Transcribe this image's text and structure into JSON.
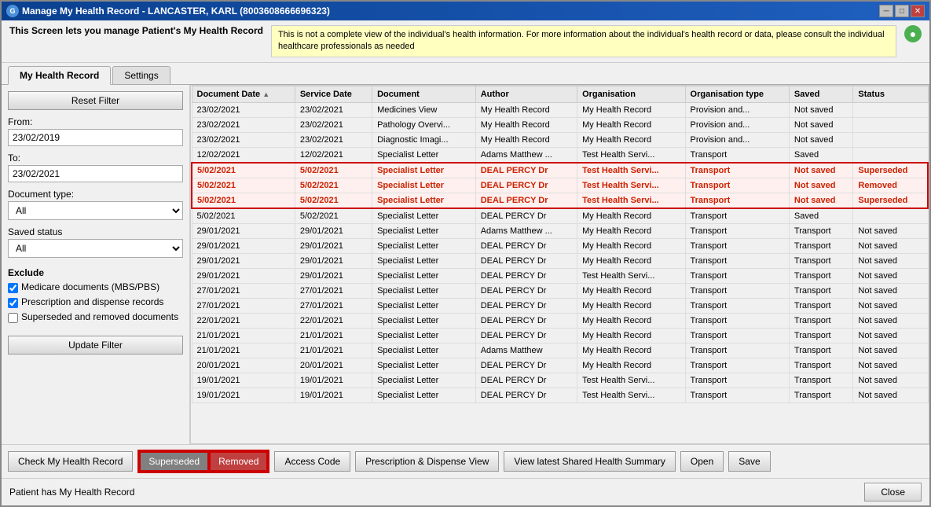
{
  "window": {
    "title": "Manage My Health Record - LANCASTER, KARL (8003608666696323)",
    "icon_label": "G"
  },
  "info_bar": {
    "left_text": "This Screen lets you manage Patient's My Health Record",
    "right_text": "This is not a complete view of the individual's health information. For more information about the individual's health record or data, please consult the individual healthcare professionals as needed"
  },
  "tabs": [
    {
      "label": "My Health Record",
      "active": true
    },
    {
      "label": "Settings",
      "active": false
    }
  ],
  "filter": {
    "reset_label": "Reset Filter",
    "from_label": "From:",
    "from_value": "23/02/2019",
    "to_label": "To:",
    "to_value": "23/02/2021",
    "doc_type_label": "Document type:",
    "doc_type_value": "All",
    "saved_status_label": "Saved status",
    "saved_status_value": "All",
    "exclude_title": "Exclude",
    "checkboxes": [
      {
        "label": "Medicare documents (MBS/PBS)",
        "checked": true
      },
      {
        "label": "Prescription and dispense records",
        "checked": true
      },
      {
        "label": "Superseded and removed documents",
        "checked": false
      }
    ],
    "update_label": "Update Filter"
  },
  "table": {
    "columns": [
      "Document Date",
      "Service Date",
      "Document",
      "Author",
      "Organisation",
      "Organisation type",
      "Saved",
      "Status"
    ],
    "rows": [
      {
        "doc_date": "23/02/2021",
        "svc_date": "23/02/2021",
        "document": "Medicines View",
        "author": "My Health Record",
        "org": "My Health Record",
        "org_type": "Provision and...",
        "saved": "Not saved",
        "status": "",
        "highlighted": false
      },
      {
        "doc_date": "23/02/2021",
        "svc_date": "23/02/2021",
        "document": "Pathology Overvi...",
        "author": "My Health Record",
        "org": "My Health Record",
        "org_type": "Provision and...",
        "saved": "Not saved",
        "status": "",
        "highlighted": false
      },
      {
        "doc_date": "23/02/2021",
        "svc_date": "23/02/2021",
        "document": "Diagnostic Imagi...",
        "author": "My Health Record",
        "org": "My Health Record",
        "org_type": "Provision and...",
        "saved": "Not saved",
        "status": "",
        "highlighted": false
      },
      {
        "doc_date": "12/02/2021",
        "svc_date": "12/02/2021",
        "document": "Specialist Letter",
        "author": "Adams Matthew ...",
        "org": "Test Health Servi...",
        "org_type": "Transport",
        "saved": "Saved",
        "status": "",
        "highlighted": false
      },
      {
        "doc_date": "5/02/2021",
        "svc_date": "5/02/2021",
        "document": "Specialist Letter",
        "author": "DEAL PERCY  Dr",
        "org": "Test Health Servi...",
        "org_type": "Transport",
        "saved": "Not saved",
        "status": "Superseded",
        "highlighted": true
      },
      {
        "doc_date": "5/02/2021",
        "svc_date": "5/02/2021",
        "document": "Specialist Letter",
        "author": "DEAL PERCY  Dr",
        "org": "Test Health Servi...",
        "org_type": "Transport",
        "saved": "Not saved",
        "status": "Removed",
        "highlighted": true
      },
      {
        "doc_date": "5/02/2021",
        "svc_date": "5/02/2021",
        "document": "Specialist Letter",
        "author": "DEAL PERCY  Dr",
        "org": "Test Health Servi...",
        "org_type": "Transport",
        "saved": "Not saved",
        "status": "Superseded",
        "highlighted": true
      },
      {
        "doc_date": "5/02/2021",
        "svc_date": "5/02/2021",
        "document": "Specialist Letter",
        "author": "DEAL PERCY  Dr",
        "org": "My Health Record",
        "org_type": "Transport",
        "saved": "Saved",
        "status": "",
        "highlighted": false
      },
      {
        "doc_date": "29/01/2021",
        "svc_date": "29/01/2021",
        "document": "Specialist Letter",
        "author": "Adams Matthew ...",
        "org": "My Health Record",
        "org_type": "Transport",
        "saved": "Transport",
        "status": "Not saved",
        "highlighted": false
      },
      {
        "doc_date": "29/01/2021",
        "svc_date": "29/01/2021",
        "document": "Specialist Letter",
        "author": "DEAL PERCY  Dr",
        "org": "My Health Record",
        "org_type": "Transport",
        "saved": "Transport",
        "status": "Not saved",
        "highlighted": false
      },
      {
        "doc_date": "29/01/2021",
        "svc_date": "29/01/2021",
        "document": "Specialist Letter",
        "author": "DEAL PERCY  Dr",
        "org": "My Health Record",
        "org_type": "Transport",
        "saved": "Transport",
        "status": "Not saved",
        "highlighted": false
      },
      {
        "doc_date": "29/01/2021",
        "svc_date": "29/01/2021",
        "document": "Specialist Letter",
        "author": "DEAL PERCY  Dr",
        "org": "Test Health Servi...",
        "org_type": "Transport",
        "saved": "Transport",
        "status": "Not saved",
        "highlighted": false
      },
      {
        "doc_date": "27/01/2021",
        "svc_date": "27/01/2021",
        "document": "Specialist Letter",
        "author": "DEAL PERCY  Dr",
        "org": "My Health Record",
        "org_type": "Transport",
        "saved": "Transport",
        "status": "Not saved",
        "highlighted": false
      },
      {
        "doc_date": "27/01/2021",
        "svc_date": "27/01/2021",
        "document": "Specialist Letter",
        "author": "DEAL PERCY  Dr",
        "org": "My Health Record",
        "org_type": "Transport",
        "saved": "Transport",
        "status": "Not saved",
        "highlighted": false
      },
      {
        "doc_date": "22/01/2021",
        "svc_date": "22/01/2021",
        "document": "Specialist Letter",
        "author": "DEAL PERCY  Dr",
        "org": "My Health Record",
        "org_type": "Transport",
        "saved": "Transport",
        "status": "Not saved",
        "highlighted": false
      },
      {
        "doc_date": "21/01/2021",
        "svc_date": "21/01/2021",
        "document": "Specialist Letter",
        "author": "DEAL PERCY  Dr",
        "org": "My Health Record",
        "org_type": "Transport",
        "saved": "Transport",
        "status": "Not saved",
        "highlighted": false
      },
      {
        "doc_date": "21/01/2021",
        "svc_date": "21/01/2021",
        "document": "Specialist Letter",
        "author": "Adams Matthew",
        "org": "My Health Record",
        "org_type": "Transport",
        "saved": "Transport",
        "status": "Not saved",
        "highlighted": false
      },
      {
        "doc_date": "20/01/2021",
        "svc_date": "20/01/2021",
        "document": "Specialist Letter",
        "author": "DEAL PERCY  Dr",
        "org": "My Health Record",
        "org_type": "Transport",
        "saved": "Transport",
        "status": "Not saved",
        "highlighted": false
      },
      {
        "doc_date": "19/01/2021",
        "svc_date": "19/01/2021",
        "document": "Specialist Letter",
        "author": "DEAL PERCY  Dr",
        "org": "Test Health Servi...",
        "org_type": "Transport",
        "saved": "Transport",
        "status": "Not saved",
        "highlighted": false
      },
      {
        "doc_date": "19/01/2021",
        "svc_date": "19/01/2021",
        "document": "Specialist Letter",
        "author": "DEAL PERCY  Dr",
        "org": "Test Health Servi...",
        "org_type": "Transport",
        "saved": "Transport",
        "status": "Not saved",
        "highlighted": false
      }
    ]
  },
  "bottom_buttons": {
    "check_label": "Check My Health Record",
    "superseded_label": "Superseded",
    "removed_label": "Removed",
    "access_code_label": "Access Code",
    "prescription_label": "Prescription & Dispense View",
    "shared_health_label": "View latest Shared Health Summary",
    "open_label": "Open",
    "save_label": "Save"
  },
  "status_bar": {
    "text": "Patient has My Health Record",
    "close_label": "Close"
  }
}
